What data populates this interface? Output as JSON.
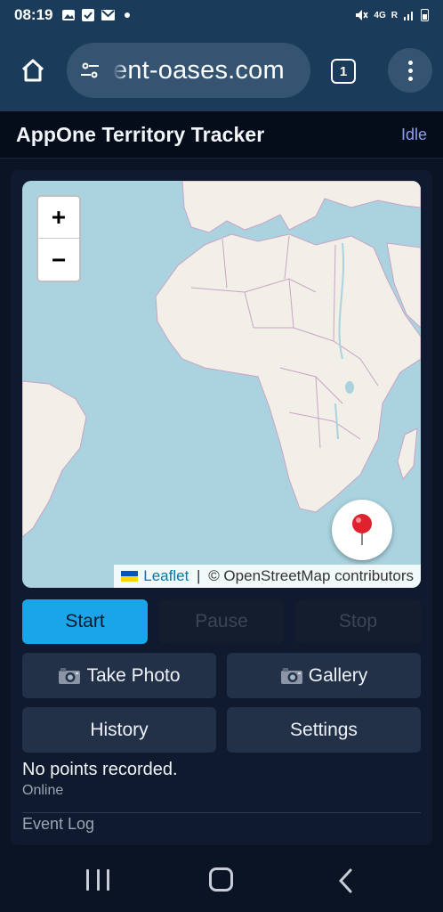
{
  "status_bar": {
    "time": "08:19",
    "network": "4G",
    "network_sub": "R"
  },
  "browser": {
    "url": "ent-oases.com",
    "tab_count": "1",
    "icons": [
      "home-icon",
      "site-settings-icon",
      "tab-switcher-icon",
      "more-vert-icon"
    ]
  },
  "app": {
    "title": "AppOne Territory Tracker",
    "status": "Idle"
  },
  "map": {
    "zoom_in_label": "+",
    "zoom_out_label": "−",
    "attribution_link": "Leaflet",
    "attribution_separator": " | ",
    "attribution_text": "© OpenStreetMap contributors",
    "colors": {
      "water": "#aad3df",
      "land": "#f2efe9",
      "borders": "#c9a3c4"
    }
  },
  "controls": {
    "start": "Start",
    "pause": "Pause",
    "stop": "Stop",
    "take_photo": "Take Photo",
    "gallery": "Gallery",
    "history": "History",
    "settings": "Settings"
  },
  "status": {
    "points": "No points recorded.",
    "connection": "Online",
    "event_log": "Event Log"
  },
  "colors": {
    "accent": "#1aa5e8",
    "browser_bar": "#1a3b59",
    "app_bg": "#0b1424"
  }
}
